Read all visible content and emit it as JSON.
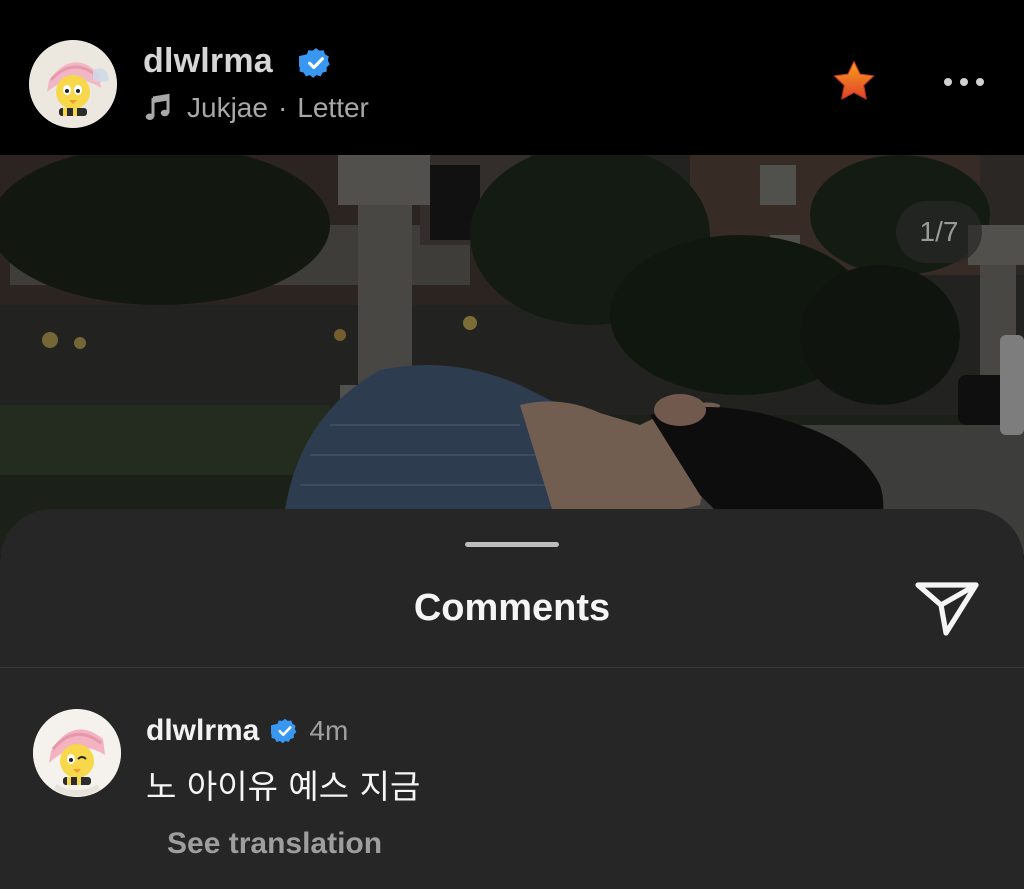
{
  "header": {
    "username": "dlwlrma",
    "music_artist": "Jukjae",
    "music_separator": "·",
    "music_title": "Letter"
  },
  "post": {
    "page_counter": "1/7"
  },
  "comments_sheet": {
    "title": "Comments",
    "comments": [
      {
        "username": "dlwlrma",
        "time": "4m",
        "text": "노 아이유 예스 지금",
        "translate_label": "See translation"
      }
    ]
  },
  "colors": {
    "verified": "#3897f0",
    "star_top": "#f7a11c",
    "star_bottom": "#e0402a",
    "sheet_bg": "#262626"
  },
  "icons": [
    "music-note-icon",
    "verified-badge-icon",
    "favorite-star-icon",
    "more-options-icon",
    "send-icon"
  ]
}
